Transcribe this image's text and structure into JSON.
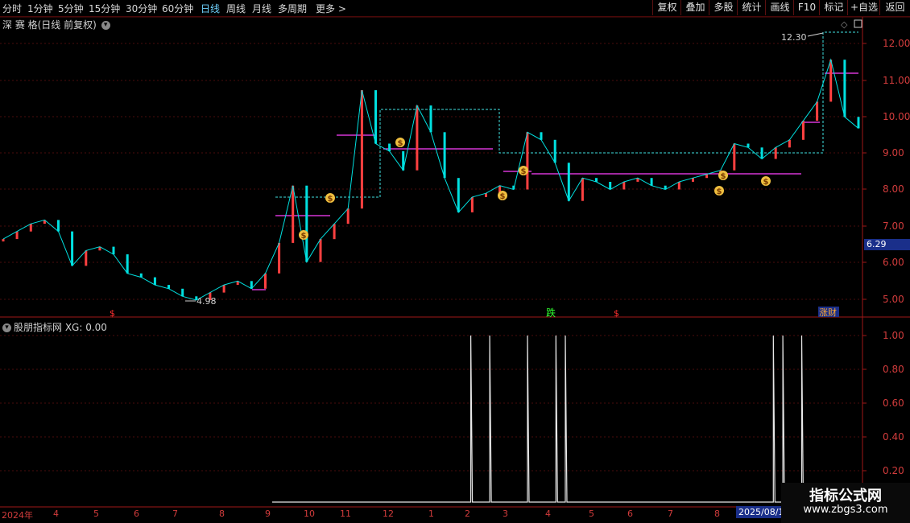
{
  "toolbar": {
    "periods": [
      "分时",
      "1分钟",
      "5分钟",
      "15分钟",
      "30分钟",
      "60分钟",
      "日线",
      "周线",
      "月线",
      "多周期",
      "更多"
    ],
    "active_period": "日线",
    "right_buttons": [
      "复权",
      "叠加",
      "多股",
      "统计",
      "画线",
      "F10",
      "标记",
      "+自选",
      "返回"
    ]
  },
  "main_chart": {
    "title": "深 赛 格(日线 前复权)",
    "y_ticks": [
      "12.00",
      "11.00",
      "10.00",
      "9.00",
      "8.00",
      "7.00",
      "6.00",
      "5.00"
    ],
    "current_price": "6.29",
    "high_label": "12.30",
    "low_label": "4.98",
    "markers": [
      "$",
      "跌",
      "$",
      "涨财"
    ],
    "dollar_marker": "$"
  },
  "indicator": {
    "title": "股朋指标网  XG: 0.00",
    "y_ticks": [
      "1.00",
      "0.80",
      "0.60",
      "0.40",
      "0.20"
    ]
  },
  "x_axis": {
    "labels": [
      "2024年",
      "4",
      "5",
      "6",
      "7",
      "8",
      "9",
      "10",
      "11",
      "12",
      "1",
      "2",
      "3",
      "4",
      "5",
      "6",
      "7",
      "8",
      "9"
    ],
    "cursor_date": "2025/08/1"
  },
  "watermark": {
    "line1": "指标公式网",
    "line2": "www.zbgs3.com"
  },
  "colors": {
    "up": "#ff4040",
    "down": "#00e0e0",
    "accent": "#6fd3ff",
    "axis": "#d23c3c"
  },
  "chart_data": {
    "type": "line",
    "title": "",
    "series": [
      {
        "values": [
          6.7,
          6.9,
          7.1,
          7.2,
          6.9,
          6.0,
          6.4,
          6.5,
          6.3,
          5.8,
          5.7,
          5.5,
          5.4,
          5.2,
          5.1,
          5.3,
          5.5,
          5.6,
          5.4,
          5.8,
          6.6,
          8.1,
          6.1,
          6.7,
          7.1,
          7.5,
          10.6,
          9.2,
          9.0,
          8.5,
          10.2,
          9.5,
          8.3,
          7.4,
          7.8,
          7.9,
          8.1,
          8.0,
          9.5,
          9.3,
          8.7,
          7.7,
          8.3,
          8.2,
          8.0,
          8.2,
          8.3,
          8.1,
          8.0,
          8.2,
          8.3,
          8.4,
          8.5,
          9.2,
          9.1,
          8.8,
          9.1,
          9.3,
          9.8,
          10.3,
          11.4,
          9.9,
          9.6
        ]
      },
      {
        "values": [
          0,
          0,
          0,
          0,
          0,
          0,
          0,
          0,
          0,
          0,
          0,
          0,
          0,
          0,
          0,
          0,
          0,
          0,
          0,
          0,
          0,
          1,
          0,
          1,
          0,
          0,
          0,
          1,
          0,
          0,
          1,
          1,
          0,
          0,
          0,
          0,
          0,
          0,
          0,
          0,
          0,
          0,
          0,
          0,
          0,
          0,
          0,
          0,
          0,
          0,
          0,
          0,
          0,
          1,
          1,
          0,
          1,
          0,
          0,
          0,
          0,
          0,
          0
        ]
      }
    ],
    "ylim": [
      4.7,
      12.5
    ]
  }
}
